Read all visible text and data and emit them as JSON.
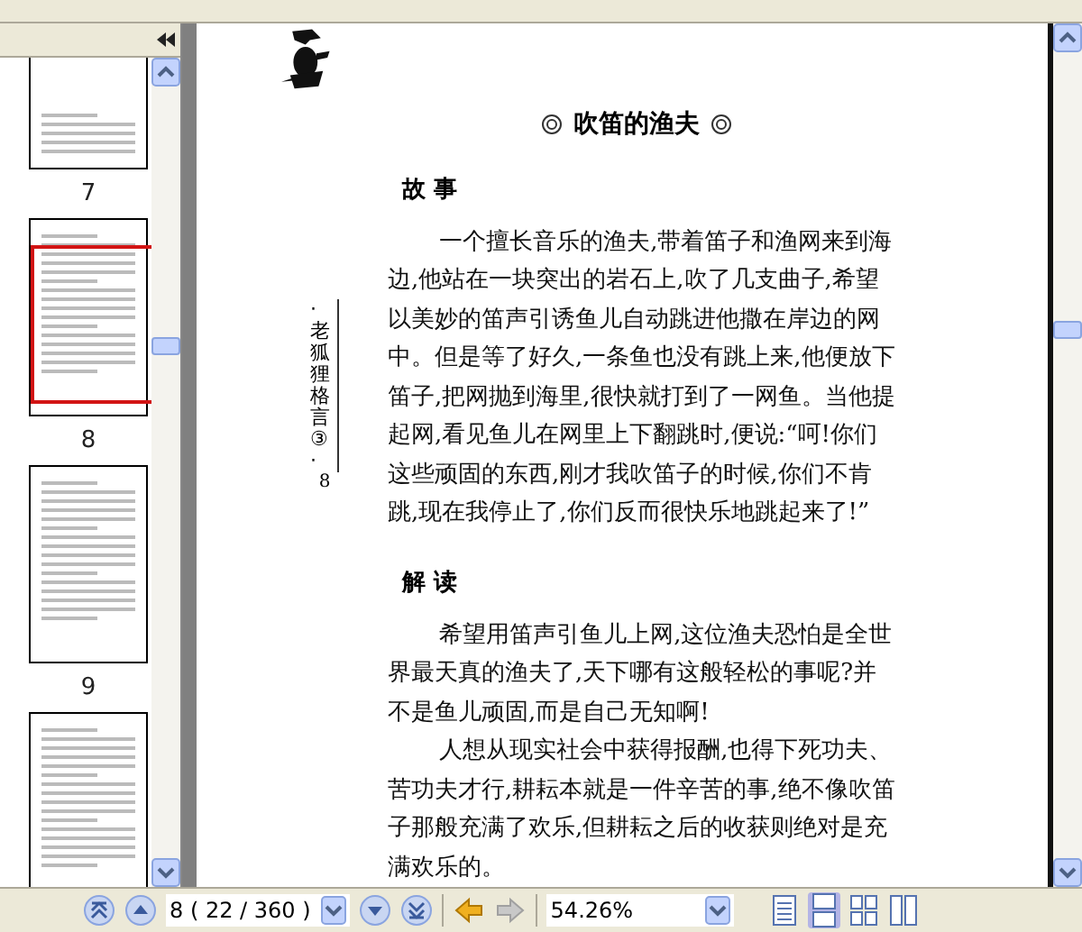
{
  "thumbnails": [
    {
      "label": "7",
      "selected": false
    },
    {
      "label": "8",
      "selected": true
    },
    {
      "label": "9",
      "selected": false
    },
    {
      "selected": false
    }
  ],
  "page": {
    "side_label": "·老狐狸格言③·",
    "side_number": "8",
    "title": "吹笛的渔夫",
    "sections": [
      {
        "heading": "故 事",
        "paragraphs": [
          "一个擅长音乐的渔夫,带着笛子和渔网来到海边,他站在一块突出的岩石上,吹了几支曲子,希望以美妙的笛声引诱鱼儿自动跳进他撒在岸边的网中。但是等了好久,一条鱼也没有跳上来,他便放下笛子,把网抛到海里,很快就打到了一网鱼。当他提起网,看见鱼儿在网里上下翻跳时,便说:“呵!你们这些顽固的东西,刚才我吹笛子的时候,你们不肯跳,现在我停止了,你们反而很快乐地跳起来了!”"
        ]
      },
      {
        "heading": "解 读",
        "paragraphs": [
          "希望用笛声引鱼儿上网,这位渔夫恐怕是全世界最天真的渔夫了,天下哪有这般轻松的事呢?并不是鱼儿顽固,而是自己无知啊!",
          "人想从现实社会中获得报酬,也得下死功夫、苦功夫才行,耕耘本就是一件辛苦的事,绝不像吹笛子那般充满了欢乐,但耕耘之后的收获则绝对是充满欢乐的。"
        ]
      }
    ]
  },
  "toolbar": {
    "page_field": "8 ( 22 / 360 )",
    "zoom_field": "54.26%",
    "history": [
      {
        "kind": "back",
        "disabled": false
      },
      {
        "kind": "forward",
        "disabled": true
      }
    ],
    "view_modes": [
      {
        "kind": "single",
        "selected": false
      },
      {
        "kind": "continuous",
        "selected": true
      },
      {
        "kind": "facing",
        "selected": false
      },
      {
        "kind": "facing-continuous",
        "selected": false
      }
    ]
  }
}
